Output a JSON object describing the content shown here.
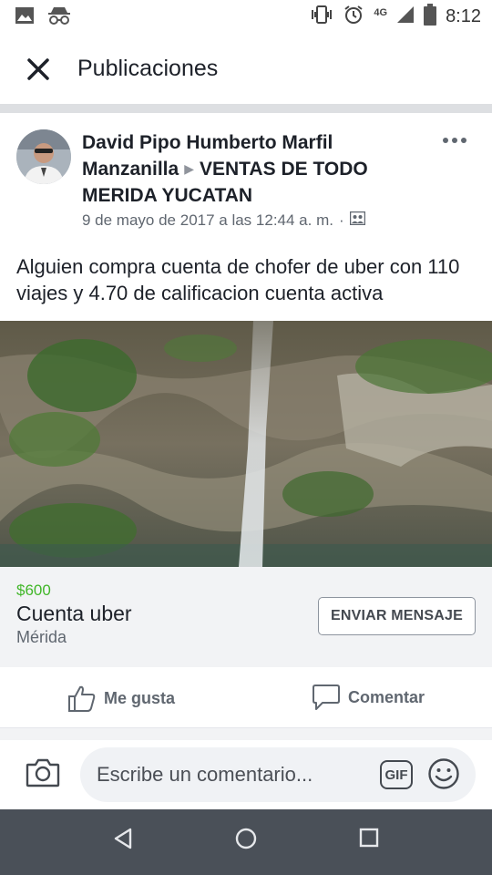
{
  "status_bar": {
    "time": "8:12",
    "network": "4G",
    "left_icons": [
      "image-icon",
      "incognito-icon"
    ],
    "right_icons": [
      "vibrate-icon",
      "alarm-icon",
      "signal-icon",
      "battery-icon"
    ]
  },
  "header": {
    "title": "Publicaciones",
    "close_icon": "close-icon"
  },
  "post": {
    "author": "David Pipo Humberto Marfil Manzanilla",
    "group": "VENTAS DE  TODO MERIDA YUCATAN",
    "timestamp": "9 de mayo de 2017 a las 12:44 a. m.",
    "separator": "·",
    "privacy_icon": "group-audience-icon",
    "text": "Alguien compra cuenta de chofer de uber con 110 viajes y 4.70 de calificacion cuenta activa",
    "listing": {
      "price": "$600",
      "title": "Cuenta uber",
      "location": "Mérida",
      "button_label": "ENVIAR MENSAJE"
    },
    "actions": {
      "like_label": "Me gusta",
      "comment_label": "Comentar"
    }
  },
  "comment_bar": {
    "placeholder": "Escribe un comentario...",
    "gif_label": "GIF"
  },
  "colors": {
    "price_green": "#42b72a",
    "text_primary": "#1d2129",
    "text_secondary": "#606770",
    "nav_bar": "#4a5058"
  }
}
